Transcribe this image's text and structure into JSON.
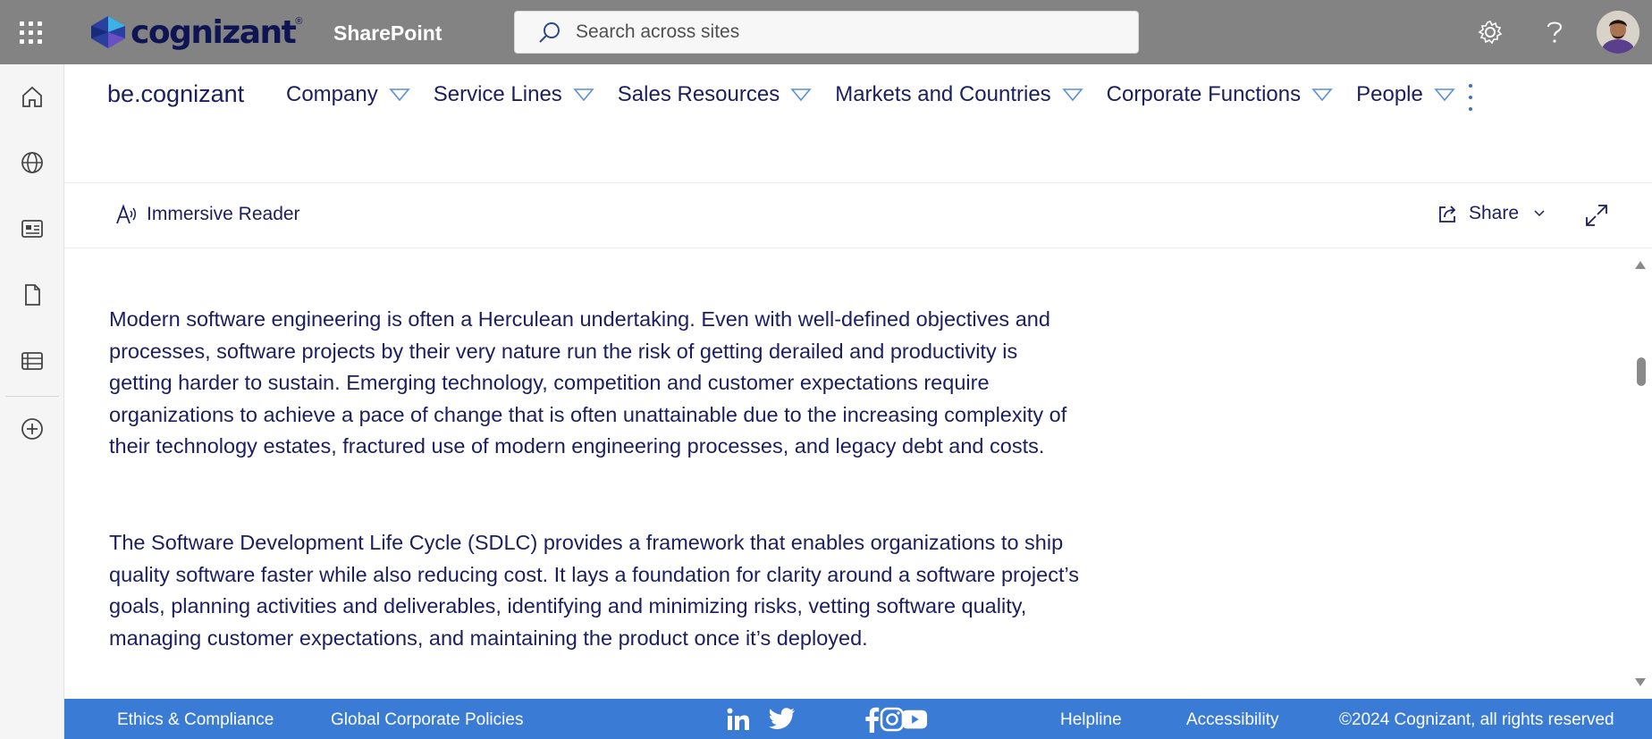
{
  "suitebar": {
    "brand": "cognizant",
    "trademark": "®",
    "app_name": "SharePoint",
    "search_placeholder": "Search across sites",
    "icons": [
      "app-launcher-icon",
      "search-icon",
      "settings-gear-icon",
      "help-icon",
      "user-avatar"
    ]
  },
  "appbar": {
    "items": [
      "home-icon",
      "globe-icon",
      "news-icon",
      "file-icon",
      "list-icon",
      "add-icon"
    ]
  },
  "site": {
    "title": "be.cognizant",
    "nav": [
      {
        "label": "Company"
      },
      {
        "label": "Service Lines"
      },
      {
        "label": "Sales Resources"
      },
      {
        "label": "Markets and Countries"
      },
      {
        "label": "Corporate Functions"
      },
      {
        "label": "People"
      }
    ]
  },
  "commandbar": {
    "immersive_reader": "Immersive Reader",
    "share": "Share"
  },
  "article": {
    "p1": "Modern software engineering is often a Herculean undertaking. Even with well-defined objectives and processes, software projects by their very nature run the risk of getting derailed and productivity is getting harder to sustain. Emerging technology, competition and customer expectations require organizations to achieve a pace of change that is often unattainable due to the increasing complexity of their technology estates, fractured use of modern engineering processes, and legacy debt and costs.",
    "p2": "The Software Development Life Cycle (SDLC) provides a framework that enables organizations to ship quality software faster while also reducing cost. It lays a foundation for clarity around a software project’s goals, planning activities and deliverables, identifying and minimizing risks, vetting software quality, managing customer expectations, and maintaining the product once it’s deployed."
  },
  "footer": {
    "ethics": "Ethics & Compliance",
    "policies": "Global Corporate Policies",
    "helpline": "Helpline",
    "accessibility": "Accessibility",
    "copyright": "©2024 Cognizant, all rights reserved",
    "social": [
      "linkedin-icon",
      "twitter-icon",
      "instagram-icon",
      "facebook-icon",
      "youtube-icon"
    ]
  },
  "colors": {
    "suitebar": "#838383",
    "text": "#1b1f5e",
    "footer": "#3a7bd5",
    "accent": "#3a6fc4"
  }
}
